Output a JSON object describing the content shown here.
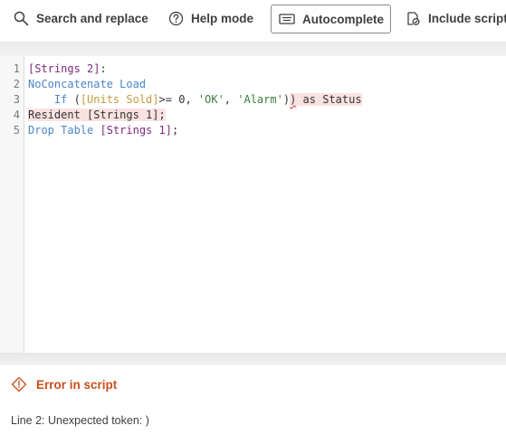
{
  "toolbar": {
    "search_label": "Search and replace",
    "help_label": "Help mode",
    "autocomplete_label": "Autocomplete",
    "include_label": "Include script"
  },
  "editor": {
    "line_numbers": [
      "1",
      "2",
      "3",
      "4",
      "5"
    ],
    "line1": {
      "table": "[Strings 2]",
      "colon": ":"
    },
    "line2": {
      "kw": "NoConcatenate Load"
    },
    "line3": {
      "indent": "    ",
      "kw_if": "If",
      "open": " (",
      "field": "[Units Sold]",
      "op": ">= ",
      "num": "0",
      "comma1": ", ",
      "str1": "'OK'",
      "comma2": ", ",
      "str2": "'Alarm'",
      "close1": ")",
      "close2": ")",
      "rest": " as Status"
    },
    "line4": {
      "kw": "Resident",
      "space": " ",
      "table": "[Strings 1]",
      "semi": ";"
    },
    "line5": {
      "kw": "Drop Table",
      "space": " ",
      "table": "[Strings 1]",
      "semi": ";"
    }
  },
  "error_panel": {
    "title": "Error in script",
    "message": "Line 2: Unexpected token: )"
  },
  "colors": {
    "error": "#c9501c",
    "keyword": "#4a86c8",
    "table": "#7c2a7a",
    "field": "#c49a3a",
    "string": "#3b7d3b"
  }
}
